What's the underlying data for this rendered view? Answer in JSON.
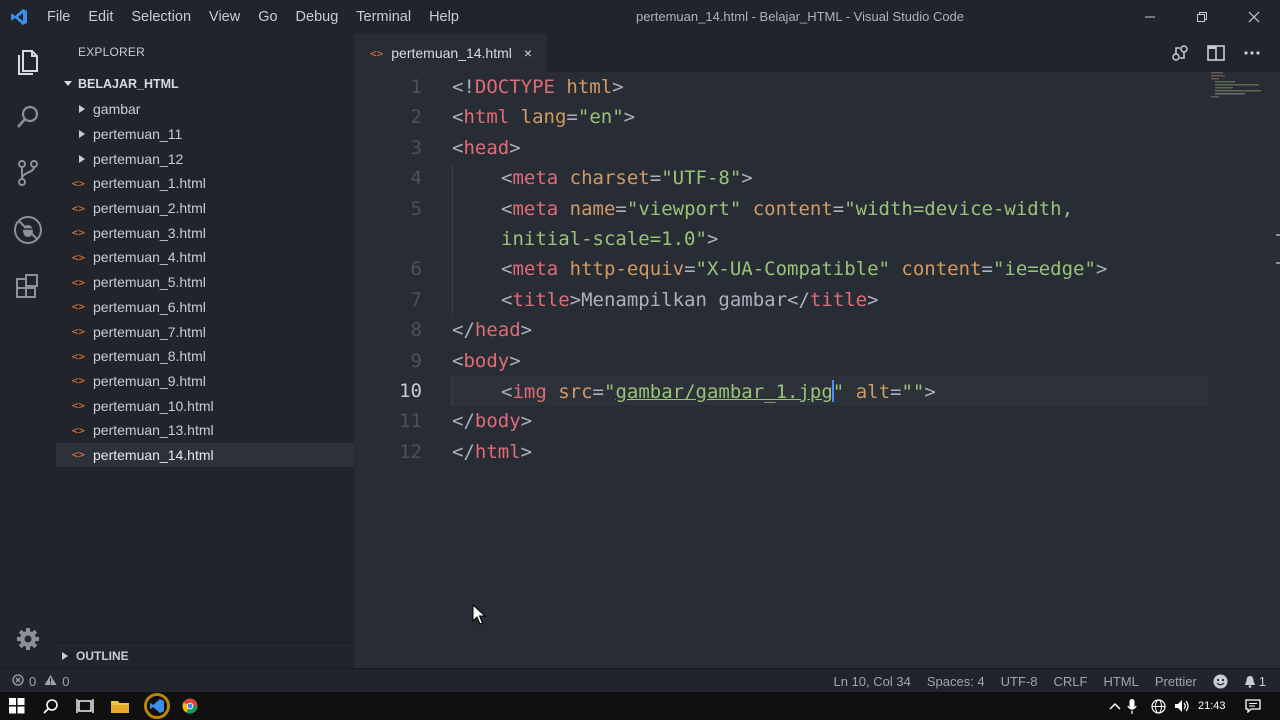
{
  "window": {
    "title": "pertemuan_14.html - Belajar_HTML - Visual Studio Code"
  },
  "menu": [
    "File",
    "Edit",
    "Selection",
    "View",
    "Go",
    "Debug",
    "Terminal",
    "Help"
  ],
  "explorer": {
    "header": "EXPLORER",
    "folder": "BELAJAR_HTML",
    "folders": [
      "gambar",
      "pertemuan_11",
      "pertemuan_12"
    ],
    "files": [
      "pertemuan_1.html",
      "pertemuan_2.html",
      "pertemuan_3.html",
      "pertemuan_4.html",
      "pertemuan_5.html",
      "pertemuan_6.html",
      "pertemuan_7.html",
      "pertemuan_8.html",
      "pertemuan_9.html",
      "pertemuan_10.html",
      "pertemuan_13.html",
      "pertemuan_14.html"
    ],
    "active_file": "pertemuan_14.html",
    "outline": "OUTLINE"
  },
  "tab": {
    "label": "pertemuan_14.html",
    "close": "×",
    "file_glyph": "<>"
  },
  "editor": {
    "line_numbers": [
      "1",
      "2",
      "3",
      "4",
      "5",
      "6",
      "7",
      "8",
      "9",
      "10",
      "11",
      "12"
    ],
    "current_line": "10",
    "code": {
      "l1": {
        "a": "<!",
        "b": "DOCTYPE",
        "c": " html",
        "d": ">"
      },
      "l2": {
        "a": "<",
        "b": "html",
        "c": " lang",
        "d": "=",
        "e": "\"en\"",
        "f": ">"
      },
      "l3": {
        "a": "<",
        "b": "head",
        "c": ">"
      },
      "l4": {
        "a": "<",
        "b": "meta",
        "c": " charset",
        "d": "=",
        "e": "\"UTF-8\"",
        "f": ">"
      },
      "l5": {
        "a": "<",
        "b": "meta",
        "c": " name",
        "d": "=",
        "e": "\"viewport\"",
        "f": " content",
        "g": "=",
        "h": "\"width=device-width,",
        "wrap": "initial-scale=1.0\"",
        "i": ">"
      },
      "l6": {
        "a": "<",
        "b": "meta",
        "c": " http-equiv",
        "d": "=",
        "e": "\"X-UA-Compatible\"",
        "f": " content",
        "g": "=",
        "h": "\"ie=edge\"",
        "i": ">"
      },
      "l7": {
        "a": "<",
        "b": "title",
        "c": ">",
        "d": "Menampilkan gambar",
        "e": "</",
        "f": "title",
        "g": ">"
      },
      "l8": {
        "a": "</",
        "b": "head",
        "c": ">"
      },
      "l9": {
        "a": "<",
        "b": "body",
        "c": ">"
      },
      "l10": {
        "a": "<",
        "b": "img",
        "c": " src",
        "d": "=",
        "e": "\"",
        "f": "gambar/gambar_1.jpg",
        "g": "\"",
        "h": " alt",
        "i": "=",
        "j": "\"\"",
        "k": ">"
      },
      "l11": {
        "a": "</",
        "b": "body",
        "c": ">"
      },
      "l12": {
        "a": "</",
        "b": "html",
        "c": ">"
      }
    }
  },
  "status": {
    "errors": "0",
    "warnings": "0",
    "position": "Ln 10, Col 34",
    "spaces": "Spaces: 4",
    "encoding": "UTF-8",
    "eol": "CRLF",
    "language": "HTML",
    "formatter": "Prettier",
    "notifications": "1"
  },
  "taskbar": {
    "clock": "21:43"
  },
  "colors": {
    "tag": "#e06c75",
    "attr": "#d19a66",
    "string": "#98c379",
    "accent": "#3b8eea",
    "file_icon": "#e37933"
  }
}
